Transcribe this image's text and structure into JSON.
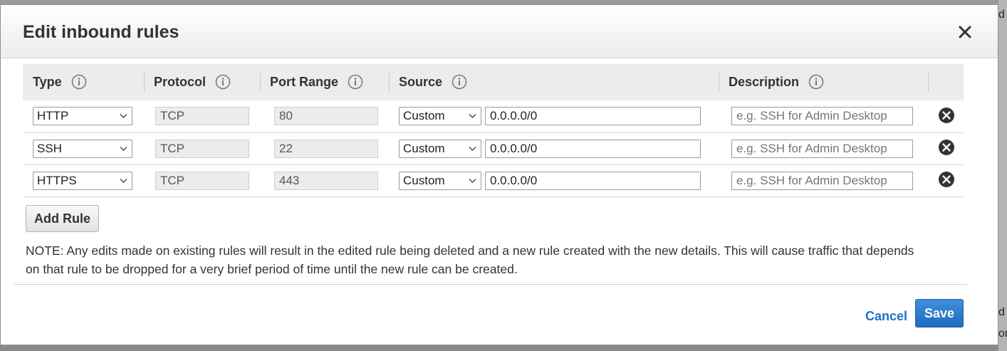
{
  "backdrop": {
    "right_fragments": [
      "d",
      "d",
      "or"
    ]
  },
  "modal": {
    "title": "Edit inbound rules"
  },
  "table": {
    "headers": {
      "type": "Type",
      "protocol": "Protocol",
      "port_range": "Port Range",
      "source": "Source",
      "description": "Description"
    },
    "rows": [
      {
        "type": "HTTP",
        "protocol": "TCP",
        "port": "80",
        "source_mode": "Custom",
        "source_cidr": "0.0.0.0/0",
        "description_placeholder": "e.g. SSH for Admin Desktop"
      },
      {
        "type": "SSH",
        "protocol": "TCP",
        "port": "22",
        "source_mode": "Custom",
        "source_cidr": "0.0.0.0/0",
        "description_placeholder": "e.g. SSH for Admin Desktop"
      },
      {
        "type": "HTTPS",
        "protocol": "TCP",
        "port": "443",
        "source_mode": "Custom",
        "source_cidr": "0.0.0.0/0",
        "description_placeholder": "e.g. SSH for Admin Desktop"
      }
    ]
  },
  "actions": {
    "add_rule": "Add Rule",
    "cancel": "Cancel",
    "save": "Save"
  },
  "note": "NOTE: Any edits made on existing rules will result in the edited rule being deleted and a new rule created with the new details. This will cause traffic that depends on that rule to be dropped for a very brief period of time until the new rule can be created.",
  "colors": {
    "primary": "#1f6bbf",
    "link": "#1a73c9",
    "header_bg": "#ececec"
  }
}
